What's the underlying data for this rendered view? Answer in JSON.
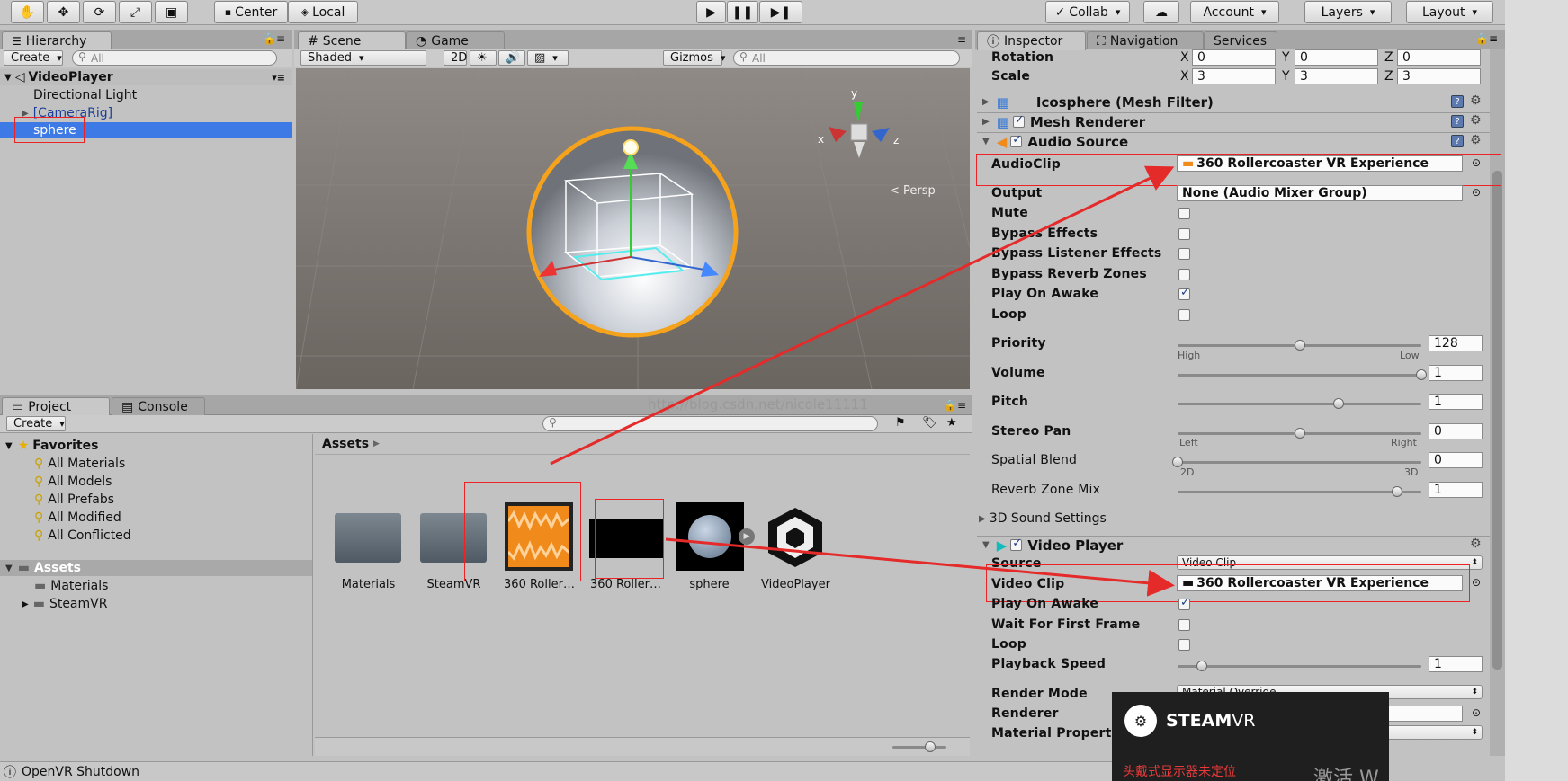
{
  "toolbar": {
    "center": "Center",
    "local": "Local",
    "collab": "Collab",
    "account": "Account",
    "layers": "Layers",
    "layout": "Layout"
  },
  "hierarchy": {
    "tab": "Hierarchy",
    "create": "Create",
    "search_placeholder": "All",
    "scene": "VideoPlayer",
    "items": [
      "Directional Light",
      "[CameraRig]",
      "sphere"
    ]
  },
  "scene": {
    "tab_scene": "Scene",
    "tab_game": "Game",
    "shaded": "Shaded",
    "mode2d": "2D",
    "gizmos": "Gizmos",
    "search_placeholder": "All",
    "persp": "< Persp",
    "axis_y": "y",
    "axis_x": "x",
    "axis_z": "z"
  },
  "project": {
    "tab_project": "Project",
    "tab_console": "Console",
    "create": "Create",
    "watermark": "http://blog.csdn.net/nicole11111",
    "favorites": "Favorites",
    "fav_items": [
      "All Materials",
      "All Models",
      "All Prefabs",
      "All Modified",
      "All Conflicted"
    ],
    "assets_root": "Assets",
    "asset_children": [
      "Materials",
      "SteamVR"
    ],
    "breadcrumb": "Assets",
    "assets": [
      "Materials",
      "SteamVR",
      "360 Roller…",
      "360 Roller…",
      "sphere",
      "VideoPlayer"
    ]
  },
  "inspector": {
    "tab_inspector": "Inspector",
    "tab_navigation": "Navigation",
    "tab_services": "Services",
    "rotation": {
      "label": "Rotation",
      "x": "0",
      "y": "0",
      "z": "0"
    },
    "scale": {
      "label": "Scale",
      "x": "3",
      "y": "3",
      "z": "3"
    },
    "axes": [
      "X",
      "Y",
      "Z"
    ],
    "mesh_filter": "Icosphere (Mesh Filter)",
    "mesh_renderer": "Mesh Renderer",
    "audio_source": {
      "title": "Audio Source",
      "audioclip_label": "AudioClip",
      "audioclip_value": "360 Rollercoaster VR Experience",
      "output_label": "Output",
      "output_value": "None (Audio Mixer Group)",
      "mute": "Mute",
      "mute_checked": false,
      "bypass_effects": "Bypass Effects",
      "bypass_effects_checked": false,
      "bypass_listener": "Bypass Listener Effects",
      "bypass_listener_checked": false,
      "bypass_reverb": "Bypass Reverb Zones",
      "bypass_reverb_checked": false,
      "play_on_awake": "Play On Awake",
      "play_on_awake_checked": true,
      "loop": "Loop",
      "loop_checked": false,
      "priority_label": "Priority",
      "priority_value": "128",
      "priority_high": "High",
      "priority_low": "Low",
      "volume_label": "Volume",
      "volume_value": "1",
      "pitch_label": "Pitch",
      "pitch_value": "1",
      "stereo_label": "Stereo Pan",
      "stereo_value": "0",
      "stereo_left": "Left",
      "stereo_right": "Right",
      "spatial_label": "Spatial Blend",
      "spatial_value": "0",
      "spatial_2d": "2D",
      "spatial_3d": "3D",
      "reverb_label": "Reverb Zone Mix",
      "reverb_value": "1",
      "sound3d": "3D Sound Settings"
    },
    "video_player": {
      "title": "Video Player",
      "source_label": "Source",
      "source_value": "Video Clip",
      "clip_label": "Video Clip",
      "clip_value": "360 Rollercoaster VR Experience",
      "play_on_awake": "Play On Awake",
      "play_on_awake_checked": true,
      "wait_first": "Wait For First Frame",
      "wait_first_checked": false,
      "loop": "Loop",
      "loop_checked": false,
      "speed_label": "Playback Speed",
      "speed_value": "1",
      "render_mode_label": "Render Mode",
      "render_mode_value": "Material Override",
      "renderer_label": "Renderer",
      "material_prop_label": "Material Propert"
    }
  },
  "sliders": {
    "priority": 0.5,
    "volume": 1.0,
    "pitch": 0.66,
    "stereo": 0.5,
    "spatial": 0.0,
    "reverb": 0.9,
    "speed": 0.1
  },
  "steamvr": {
    "logo": "STEAM",
    "vr": "VR",
    "message": "头戴式显示器未定位"
  },
  "windows_watermark": "激活 W",
  "status_bar": "OpenVR Shutdown",
  "colors": {
    "selection": "#3d7ae6",
    "annotation": "#e52a2a",
    "audio_orange": "#f08a1a"
  }
}
